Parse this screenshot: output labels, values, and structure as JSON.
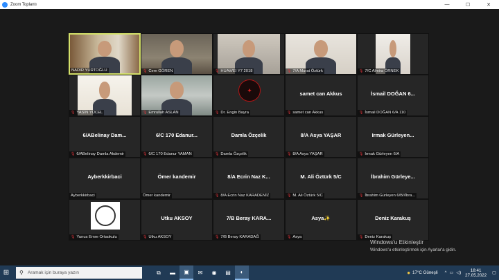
{
  "window": {
    "title": "Zoom Toplantı",
    "controls": [
      "—",
      "☐",
      "✕"
    ]
  },
  "participants": [
    {
      "label": "NADIR YURTOĞLU",
      "mic_muted": false,
      "video": "v1",
      "active": true
    },
    {
      "label": "Cem GÖREN",
      "mic_muted": true,
      "video": "v2"
    },
    {
      "label": "HUAWEI Y7 2018",
      "mic_muted": true,
      "video": "v3"
    },
    {
      "label": "7/A Murat Öztürk",
      "mic_muted": true,
      "video": "v4"
    },
    {
      "label": "7/C Almira ÖRNEK",
      "mic_muted": true,
      "video": "v5"
    },
    {
      "label": "YASİN YÜCEL",
      "mic_muted": true,
      "video": "v6"
    },
    {
      "label": "Emrullah ASLAN",
      "mic_muted": true,
      "video": "v7"
    },
    {
      "label": "Dr. Engin Bayra",
      "mic_muted": true,
      "video": "emblem"
    },
    {
      "label": "samet can Akkus",
      "center": "samet can Akkus",
      "mic_muted": true
    },
    {
      "label": "İsmail DOĞAN 6/A 110",
      "center": "İsmail DOĞAN 6...",
      "mic_muted": true
    },
    {
      "label": "6/ABelinay Damla Akdemir",
      "center": "6/ABelinay Dam...",
      "mic_muted": true
    },
    {
      "label": "6/C 170 Edanur YAMAN",
      "center": "6/C 170 Edanur...",
      "mic_muted": true
    },
    {
      "label": "Damla Özçelik",
      "center": "Damla Özçelik",
      "mic_muted": true
    },
    {
      "label": "8/A Asya YAŞAR",
      "center": "8/A Asya YAŞAR",
      "mic_muted": true
    },
    {
      "label": "Irmak Gürleyen 6/A",
      "center": "Irmak Gürleyen...",
      "mic_muted": true
    },
    {
      "label": "Ayberkkirbaci",
      "center": "Ayberkkirbaci",
      "mic_muted": false
    },
    {
      "label": "Ömer kandemir",
      "center": "Ömer kandemir",
      "mic_muted": false
    },
    {
      "label": "8/A Ecrin Naz KARADENİZ",
      "center": "8/A Ecrin Naz K...",
      "mic_muted": true
    },
    {
      "label": "M. Ali Öztürk 5/C",
      "center": "M. Ali Öztürk 5/C",
      "mic_muted": true
    },
    {
      "label": "İbrahim Gürleyen 6/B//İbra...",
      "center": "İbrahim Gürleye...",
      "mic_muted": true
    },
    {
      "label": "Yunus Emre Ortaokulu",
      "mic_muted": true,
      "video": "logo"
    },
    {
      "label": "Utku AKSOY",
      "center": "Utku AKSOY",
      "mic_muted": true
    },
    {
      "label": "7/B Beray KARADAĞ",
      "center": "7/B Beray KARA...",
      "mic_muted": true
    },
    {
      "label": "Asya",
      "center": "Asya✨",
      "mic_muted": true
    },
    {
      "label": "Deniz Karakuş",
      "center": "Deniz Karakuş",
      "mic_muted": true
    }
  ],
  "watermark": {
    "line1": "Windows'u Etkinleştir",
    "line2": "Windows'u etkinleştirmek için Ayarlar'a gidin."
  },
  "taskbar": {
    "search_placeholder": "Aramak için buraya yazın",
    "icons": [
      "task-view-icon",
      "file-explorer-icon",
      "zoom-icon",
      "mail-icon",
      "chrome-icon",
      "files-icon",
      "edge-icon"
    ],
    "weather": "17°C  Güneşli",
    "time": "18:41",
    "date": "27.05.2022"
  },
  "colors": {
    "active_speaker": "#d4e16a",
    "muted_mic": "#e0343a",
    "taskbar": "#203a55"
  }
}
